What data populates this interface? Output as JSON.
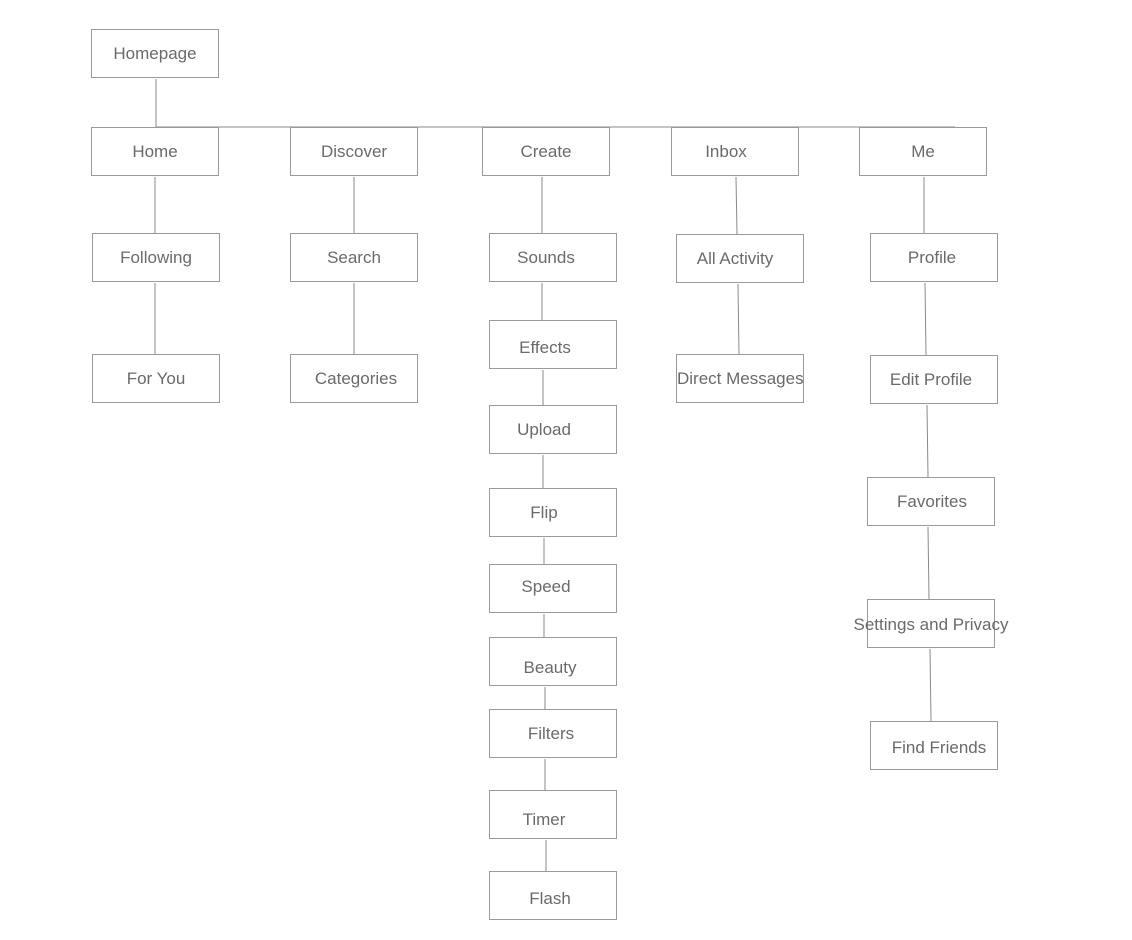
{
  "root": {
    "label": "Homepage"
  },
  "sections": [
    {
      "label": "Home",
      "children": [
        "Following",
        "For You"
      ]
    },
    {
      "label": "Discover",
      "children": [
        "Search",
        "Categories"
      ]
    },
    {
      "label": "Create",
      "children": [
        "Sounds",
        "Effects",
        "Upload",
        "Flip",
        "Speed",
        "Beauty",
        "Filters",
        "Timer",
        "Flash"
      ]
    },
    {
      "label": "Inbox",
      "children": [
        "All Activity",
        "Direct Messages"
      ]
    },
    {
      "label": "Me",
      "children": [
        "Profile",
        "Edit Profile",
        "Favorites",
        "Settings and Privacy",
        "Find Friends"
      ]
    }
  ],
  "colors": {
    "border": "#9a9a9a",
    "text": "#6a6a6a",
    "line": "#8a8a8a"
  }
}
